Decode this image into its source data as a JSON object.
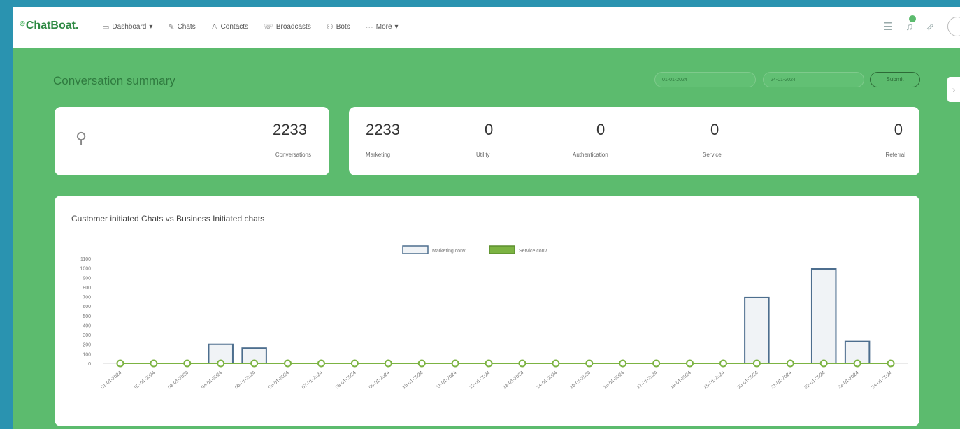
{
  "app": {
    "logo": "ChatBoat."
  },
  "nav": [
    {
      "label": "Dashboard",
      "icon": "monitor-icon",
      "caret": "▾"
    },
    {
      "label": "Chats",
      "icon": "chat-icon"
    },
    {
      "label": "Contacts",
      "icon": "contacts-icon"
    },
    {
      "label": "Broadcasts",
      "icon": "broadcast-icon"
    },
    {
      "label": "Bots",
      "icon": "bot-icon"
    },
    {
      "label": "More",
      "icon": "more-icon",
      "caret": "▾"
    }
  ],
  "header_icons": [
    "inbox-icon",
    "bell-icon",
    "export-icon",
    "avatar"
  ],
  "page": {
    "title": "Conversation summary",
    "start_date": "01-01-2024",
    "end_date": "24-01-2024",
    "submit_label": "Submit"
  },
  "summary": {
    "total": {
      "value": "2233",
      "label": "Conversations"
    },
    "categories": [
      {
        "value": "2233",
        "label": "Marketing"
      },
      {
        "value": "0",
        "label": "Utility"
      },
      {
        "value": "0",
        "label": "Authentication"
      },
      {
        "value": "0",
        "label": "Service"
      },
      {
        "value": "0",
        "label": "Referral"
      }
    ]
  },
  "colors": {
    "background": "#5cbb6e",
    "bar_stroke": "#4d6e8e",
    "bar_fill": "#f0f3f6",
    "line": "#7cb342"
  },
  "chart_data": {
    "type": "bar",
    "title": "Customer initiated Chats vs Business Initiated chats",
    "categories": [
      "01-01-2024",
      "02-01-2024",
      "03-01-2024",
      "04-01-2024",
      "05-01-2024",
      "06-01-2024",
      "07-01-2024",
      "08-01-2024",
      "09-01-2024",
      "10-01-2024",
      "11-01-2024",
      "12-01-2024",
      "13-01-2024",
      "14-01-2024",
      "15-01-2024",
      "16-01-2024",
      "17-01-2024",
      "18-01-2024",
      "19-01-2024",
      "20-01-2024",
      "21-01-2024",
      "22-01-2024",
      "23-01-2024",
      "24-01-2024"
    ],
    "series": [
      {
        "name": "Marketing conv",
        "type": "bar",
        "values": [
          0,
          0,
          0,
          200,
          160,
          0,
          0,
          0,
          0,
          0,
          0,
          0,
          0,
          0,
          0,
          0,
          0,
          0,
          0,
          690,
          0,
          990,
          230,
          0
        ]
      },
      {
        "name": "Service conv",
        "type": "line",
        "values": [
          0,
          0,
          0,
          0,
          0,
          0,
          0,
          0,
          0,
          0,
          0,
          0,
          0,
          0,
          0,
          0,
          0,
          0,
          0,
          0,
          0,
          0,
          0,
          0
        ]
      }
    ],
    "yticks": [
      0,
      100,
      200,
      300,
      400,
      500,
      600,
      700,
      800,
      900,
      1000,
      1100
    ],
    "ylim": [
      0,
      1100
    ],
    "legend": "top-center",
    "grid": false
  }
}
